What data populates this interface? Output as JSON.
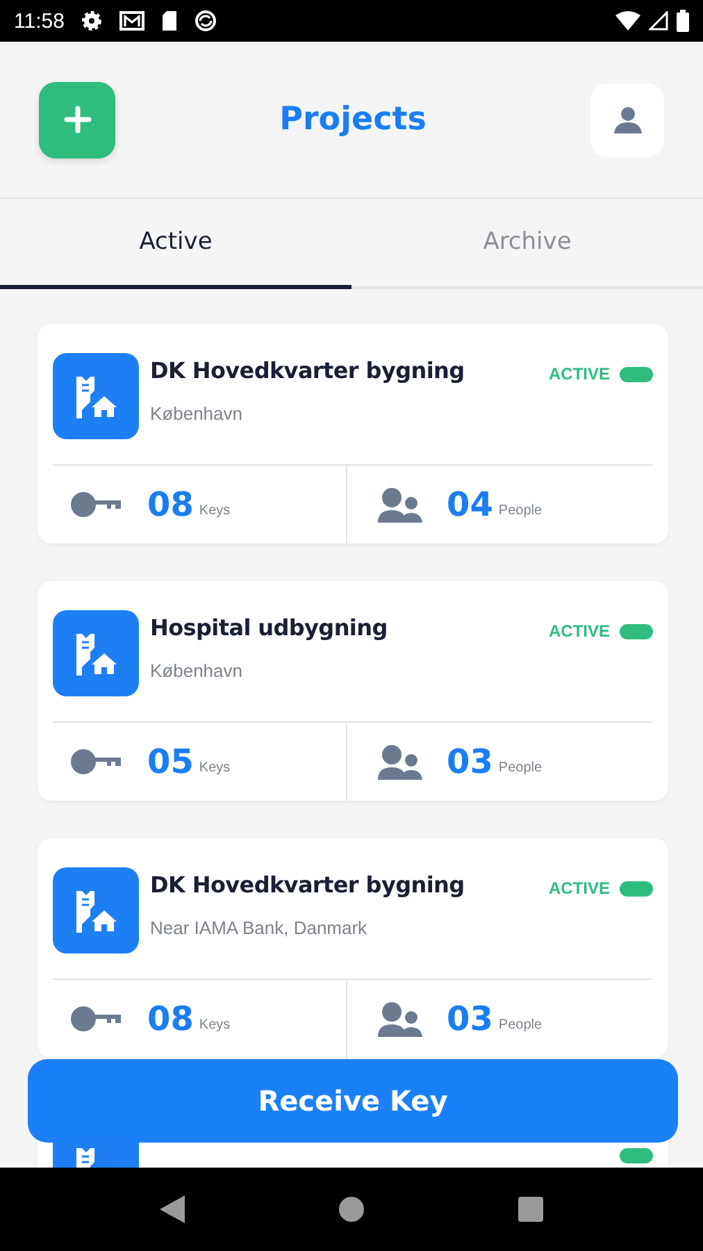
{
  "status_bar": {
    "time": "11:58"
  },
  "header": {
    "title": "Projects"
  },
  "tabs": [
    {
      "label": "Active",
      "selected": true
    },
    {
      "label": "Archive",
      "selected": false
    }
  ],
  "projects": [
    {
      "kind": "full",
      "name": "DK Hovedkvarter bygning",
      "location": "København",
      "status": {
        "label": "ACTIVE",
        "on": true
      },
      "keys": {
        "count": "08",
        "unit": "Keys"
      },
      "people": {
        "count": "04",
        "unit": "People"
      }
    },
    {
      "kind": "full",
      "name": "Hospital udbygning",
      "location": "København",
      "status": {
        "label": "ACTIVE",
        "on": true
      },
      "keys": {
        "count": "05",
        "unit": "Keys"
      },
      "people": {
        "count": "03",
        "unit": "People"
      }
    },
    {
      "kind": "full",
      "name": "DK Hovedkvarter bygning",
      "location": "Near IAMA Bank, Danmark",
      "status": {
        "label": "ACTIVE",
        "on": true
      },
      "keys": {
        "count": "08",
        "unit": "Keys"
      },
      "people": {
        "count": "03",
        "unit": "People"
      }
    },
    {
      "kind": "partial",
      "status": {
        "on": true
      }
    }
  ],
  "action_button": {
    "label": "Receive Key"
  }
}
